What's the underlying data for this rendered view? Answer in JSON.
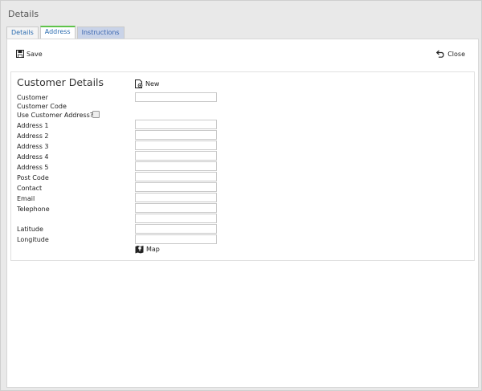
{
  "window": {
    "title": "Details"
  },
  "tabs": [
    {
      "label": "Details"
    },
    {
      "label": "Address"
    },
    {
      "label": "Instructions"
    }
  ],
  "toolbar": {
    "save_label": "Save",
    "close_label": "Close"
  },
  "section": {
    "title": "Customer Details",
    "new_label": "New",
    "map_label": "Map"
  },
  "fields": {
    "customer": {
      "label": "Customer",
      "value": ""
    },
    "customer_code": {
      "label": "Customer Code"
    },
    "use_customer_address": {
      "label": "Use Customer Address?",
      "checked": false
    },
    "address1": {
      "label": "Address 1",
      "value": ""
    },
    "address2": {
      "label": "Address 2",
      "value": ""
    },
    "address3": {
      "label": "Address 3",
      "value": ""
    },
    "address4": {
      "label": "Address 4",
      "value": ""
    },
    "address5": {
      "label": "Address 5",
      "value": ""
    },
    "post_code": {
      "label": "Post Code",
      "value": ""
    },
    "contact": {
      "label": "Contact",
      "value": ""
    },
    "email": {
      "label": "Email",
      "value": ""
    },
    "telephone": {
      "label": "Telephone",
      "value": ""
    },
    "extra": {
      "value": ""
    },
    "latitude": {
      "label": "Latitude",
      "value": ""
    },
    "longitude": {
      "label": "Longitude",
      "value": ""
    }
  }
}
